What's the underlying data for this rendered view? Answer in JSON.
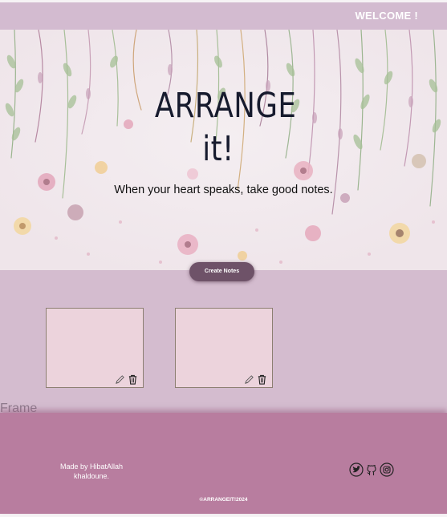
{
  "header": {
    "welcome": "WELCOME !"
  },
  "hero": {
    "title_line1": "ARRANGE",
    "title_line2": "it!",
    "subtitle": "When your heart speaks, take good notes."
  },
  "actions": {
    "create_notes": "Create Notes"
  },
  "notes": [
    {
      "icons": [
        "pencil-icon",
        "trash-icon"
      ]
    },
    {
      "icons": [
        "pencil-icon",
        "trash-icon"
      ]
    }
  ],
  "frame_label": "Frame",
  "footer": {
    "made_by": "Made by HibatAllah khaldoune.",
    "socials": [
      "twitter-icon",
      "github-icon",
      "instagram-icon"
    ],
    "copyright": "©ARRANGEIT!2024"
  },
  "colors": {
    "topbar": "#d3bbd0",
    "body": "#d4bccf",
    "note": "#ecd3dc",
    "button": "#6e5268",
    "footer": "#b87d9f",
    "title": "#171b2e"
  }
}
